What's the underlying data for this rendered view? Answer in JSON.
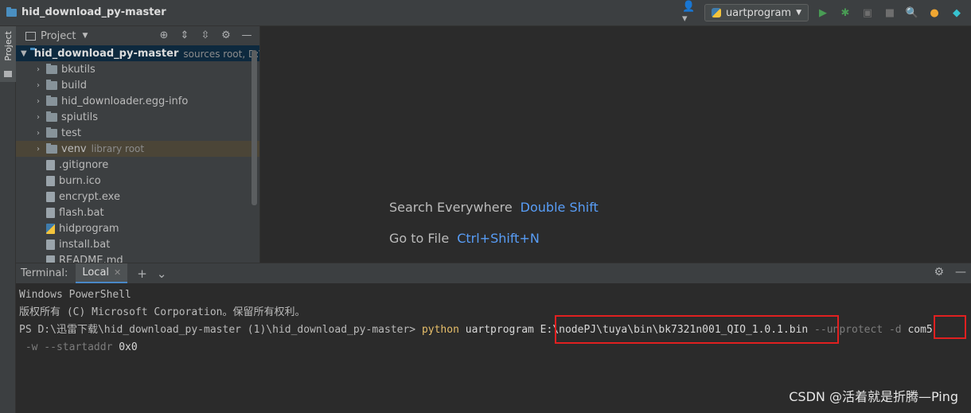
{
  "navbar": {
    "project_title": "hid_download_py-master",
    "run_config": "uartprogram"
  },
  "tool_strip": {
    "project_tab": "Project"
  },
  "project_panel": {
    "header": "Project",
    "root": {
      "name": "hid_download_py-master",
      "hint": "sources root,  D:\\迅"
    },
    "items": [
      {
        "name": "bkutils",
        "type": "folder",
        "expandable": true,
        "hint": ""
      },
      {
        "name": "build",
        "type": "folder",
        "expandable": true,
        "hint": ""
      },
      {
        "name": "hid_downloader.egg-info",
        "type": "folder",
        "expandable": true,
        "hint": ""
      },
      {
        "name": "spiutils",
        "type": "folder",
        "expandable": true,
        "hint": ""
      },
      {
        "name": "test",
        "type": "folder",
        "expandable": true,
        "hint": ""
      },
      {
        "name": "venv",
        "type": "folder",
        "expandable": true,
        "hint": "library root"
      },
      {
        "name": ".gitignore",
        "type": "file",
        "expandable": false,
        "hint": ""
      },
      {
        "name": "burn.ico",
        "type": "file",
        "expandable": false,
        "hint": ""
      },
      {
        "name": "encrypt.exe",
        "type": "file",
        "expandable": false,
        "hint": ""
      },
      {
        "name": "flash.bat",
        "type": "file",
        "expandable": false,
        "hint": ""
      },
      {
        "name": "hidprogram",
        "type": "py",
        "expandable": false,
        "hint": ""
      },
      {
        "name": "install.bat",
        "type": "file",
        "expandable": false,
        "hint": ""
      },
      {
        "name": "README.md",
        "type": "file",
        "expandable": false,
        "hint": ""
      }
    ]
  },
  "editor": {
    "search_label": "Search Everywhere",
    "search_key": "Double Shift",
    "goto_label": "Go to File",
    "goto_key": "Ctrl+Shift+N"
  },
  "terminal": {
    "label": "Terminal:",
    "tab": "Local",
    "lines": {
      "l1": "Windows PowerShell",
      "l2": "版权所有 (C) Microsoft Corporation。保留所有权利。",
      "prompt": "PS D:\\迅雷下载\\hid_download_py-master (1)\\hid_download_py-master> ",
      "cmd": "python",
      "script": "uartprogram",
      "path": "E:\\nodePJ\\tuya\\bin\\bk7321n001_QIO_1.0.1.bin",
      "flags1": "--unprotect -d",
      "port": "com5",
      "flags2": " -w --startaddr",
      "addr": "0x0"
    }
  },
  "watermark": "CSDN @活着就是折腾—Ping"
}
